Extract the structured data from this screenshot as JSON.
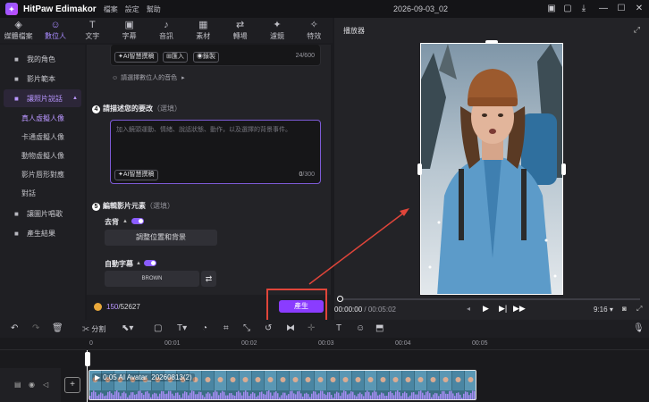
{
  "app": {
    "name": "HitPaw Edimakor",
    "menu": [
      "檔案",
      "設定",
      "幫助"
    ],
    "doc_title": "2026-09-03_02"
  },
  "tabs": [
    {
      "label": "媒體檔案",
      "icon": "media-icon",
      "glyph": "◈"
    },
    {
      "label": "數位人",
      "icon": "avatar-icon",
      "glyph": "☺",
      "active": true
    },
    {
      "label": "文字",
      "icon": "text-icon",
      "glyph": "T"
    },
    {
      "label": "字幕",
      "icon": "subtitle-icon",
      "glyph": "▣"
    },
    {
      "label": "音訊",
      "icon": "music-icon",
      "glyph": "♪"
    },
    {
      "label": "素材",
      "icon": "material-icon",
      "glyph": "▦"
    },
    {
      "label": "轉場",
      "icon": "transition-icon",
      "glyph": "⇄"
    },
    {
      "label": "濾鏡",
      "icon": "filter-icon",
      "glyph": "✦"
    },
    {
      "label": "特效",
      "icon": "effect-icon",
      "glyph": "✧"
    }
  ],
  "sidebar": {
    "items": [
      {
        "label": "我的角色",
        "icon": "user-icon"
      },
      {
        "label": "影片範本",
        "icon": "template-icon"
      },
      {
        "label": "讓照片說話",
        "icon": "photo-talk-icon",
        "expanded": true
      }
    ],
    "sub_items": [
      "真人虛擬人像",
      "卡通虛擬人像",
      "動物虛擬人像",
      "影片唇形對應",
      "對話"
    ],
    "items_after": [
      {
        "label": "讓圖片唱歌",
        "icon": "sing-icon"
      },
      {
        "label": "產生結果",
        "icon": "result-icon"
      }
    ]
  },
  "main": {
    "script_card": {
      "ai_write": "AI智慧撰稿",
      "import": "匯入",
      "record": "錄製",
      "counter": "24/600",
      "voice_prompt": "請選擇數位人的音色"
    },
    "step4": {
      "number": "4",
      "title": "請描述您的要改",
      "optional": "（選填）",
      "placeholder": "加入鏡頭運動、情緒、說話狀態、動作，以及選擇的背景事件。",
      "ai_write": "AI智慧撰稿",
      "counter_used": "0",
      "counter_total": "/300"
    },
    "step5": {
      "number": "5",
      "title": "編輯影片元素",
      "optional": "（選填）",
      "remove_bg_label": "去背",
      "adjust_button": "調整位置和背景",
      "auto_caption_label": "自動字幕",
      "caption_style": "BROWN"
    },
    "credits": {
      "used": "150",
      "total": "/52627"
    },
    "generate_label": "產生"
  },
  "player": {
    "title": "播放器",
    "time_current": "00:00:00",
    "time_total": "/ 00:05:02",
    "aspect": "9:16"
  },
  "timeline": {
    "split_label": "分割",
    "ruler": [
      "0",
      "00:01",
      "00:02",
      "00:03",
      "00:04",
      "00:05"
    ],
    "clip_label": "0:05  AI Avatar_20260813(2)"
  },
  "colors": {
    "accent": "#8a5cff",
    "generate": "#8a3cff",
    "highlight": "#e0453a"
  }
}
